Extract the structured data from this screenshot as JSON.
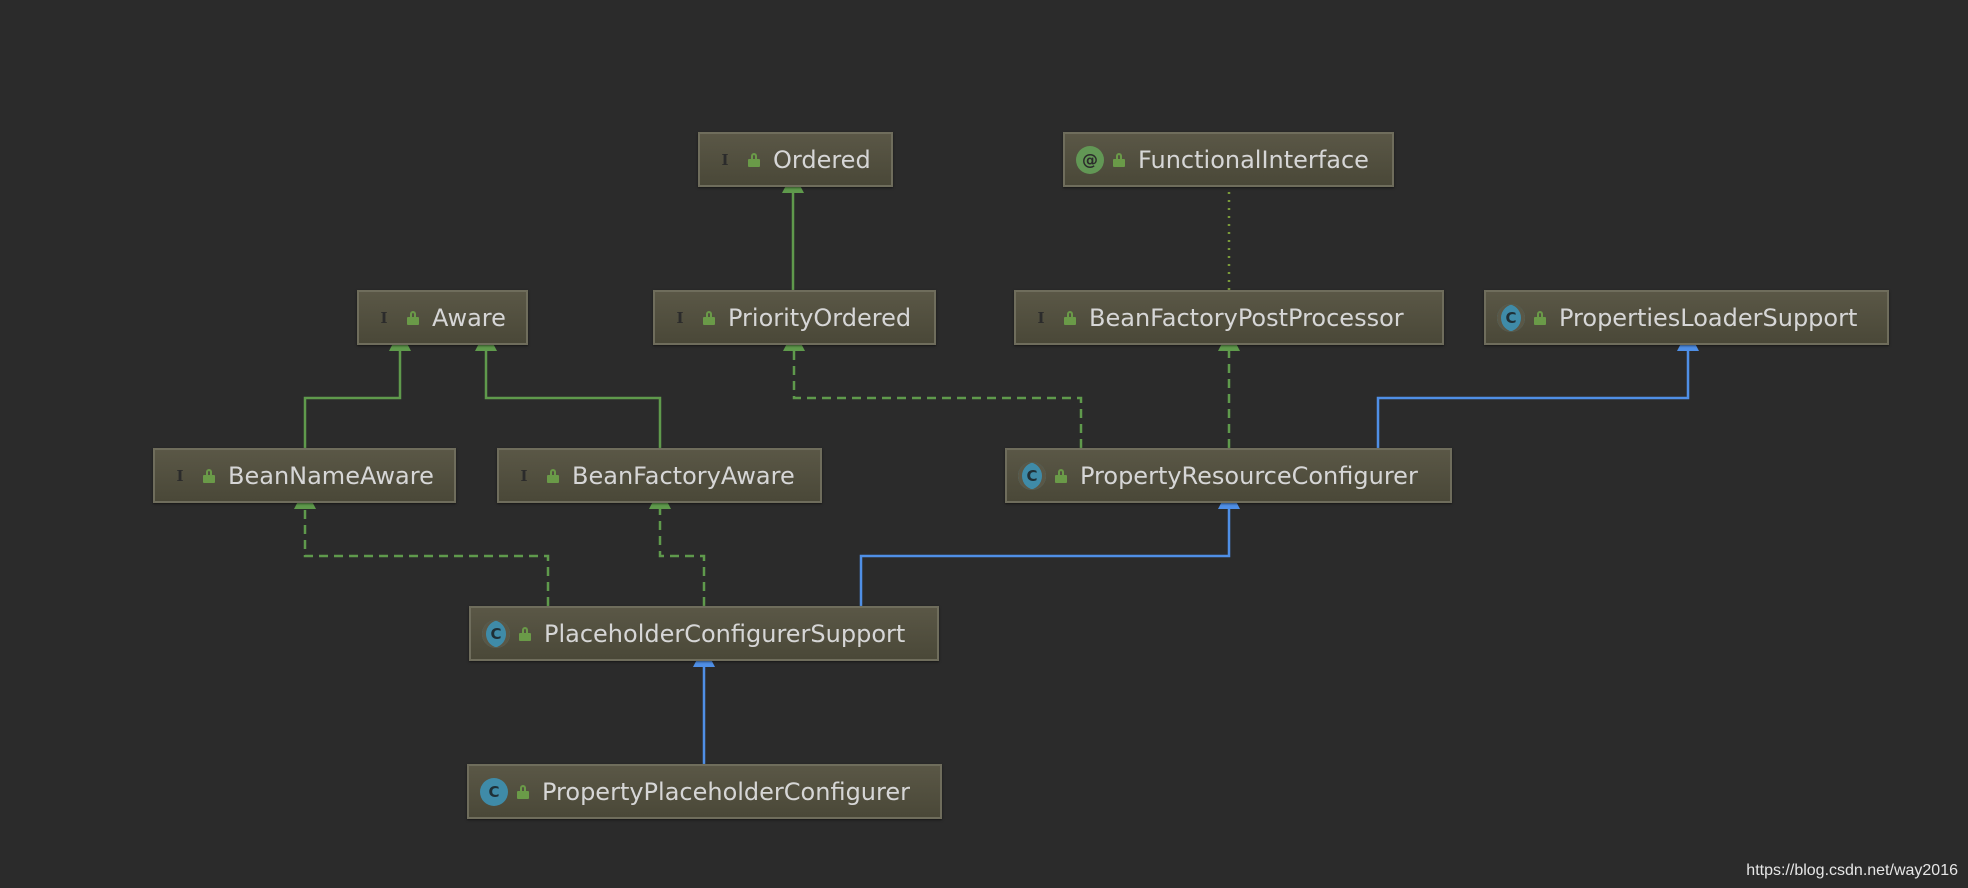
{
  "nodes": [
    {
      "id": "ordered",
      "label": "Ordered",
      "kind": "interface",
      "icon": "interface-icon"
    },
    {
      "id": "functional-interface",
      "label": "FunctionalInterface",
      "kind": "annotation",
      "icon": "annotation-icon"
    },
    {
      "id": "aware",
      "label": "Aware",
      "kind": "interface",
      "icon": "interface-icon"
    },
    {
      "id": "priority-ordered",
      "label": "PriorityOrdered",
      "kind": "interface",
      "icon": "interface-icon"
    },
    {
      "id": "bean-factory-post-processor",
      "label": "BeanFactoryPostProcessor",
      "kind": "interface",
      "icon": "interface-icon"
    },
    {
      "id": "properties-loader-support",
      "label": "PropertiesLoaderSupport",
      "kind": "abstract",
      "icon": "abstract-class-icon"
    },
    {
      "id": "bean-name-aware",
      "label": "BeanNameAware",
      "kind": "interface",
      "icon": "interface-icon"
    },
    {
      "id": "bean-factory-aware",
      "label": "BeanFactoryAware",
      "kind": "interface",
      "icon": "interface-icon"
    },
    {
      "id": "property-resource-configurer",
      "label": "PropertyResourceConfigurer",
      "kind": "abstract",
      "icon": "abstract-class-icon"
    },
    {
      "id": "placeholder-configurer-support",
      "label": "PlaceholderConfigurerSupport",
      "kind": "abstract",
      "icon": "abstract-class-icon"
    },
    {
      "id": "property-placeholder-configurer",
      "label": "PropertyPlaceholderConfigurer",
      "kind": "class",
      "icon": "class-icon"
    }
  ],
  "kind_letters": {
    "interface": "I",
    "annotation": "@",
    "class": "C",
    "abstract": "C"
  },
  "edges": [
    {
      "from": "priority-ordered",
      "to": "ordered",
      "type": "extends-interface"
    },
    {
      "from": "bean-factory-post-processor",
      "to": "functional-interface",
      "type": "annotated"
    },
    {
      "from": "bean-name-aware",
      "to": "aware",
      "type": "extends-interface"
    },
    {
      "from": "bean-factory-aware",
      "to": "aware",
      "type": "extends-interface"
    },
    {
      "from": "property-resource-configurer",
      "to": "priority-ordered",
      "type": "implements"
    },
    {
      "from": "property-resource-configurer",
      "to": "bean-factory-post-processor",
      "type": "implements"
    },
    {
      "from": "property-resource-configurer",
      "to": "properties-loader-support",
      "type": "extends-class"
    },
    {
      "from": "placeholder-configurer-support",
      "to": "bean-name-aware",
      "type": "implements"
    },
    {
      "from": "placeholder-configurer-support",
      "to": "bean-factory-aware",
      "type": "implements"
    },
    {
      "from": "placeholder-configurer-support",
      "to": "property-resource-configurer",
      "type": "extends-class"
    },
    {
      "from": "property-placeholder-configurer",
      "to": "placeholder-configurer-support",
      "type": "extends-class"
    }
  ],
  "colors": {
    "background": "#2b2b2b",
    "interface_edge": "#5f9a4c",
    "class_edge": "#4f8fe6",
    "annotation_edge": "#7a9a3a"
  },
  "watermark": "https://blog.csdn.net/way2016"
}
